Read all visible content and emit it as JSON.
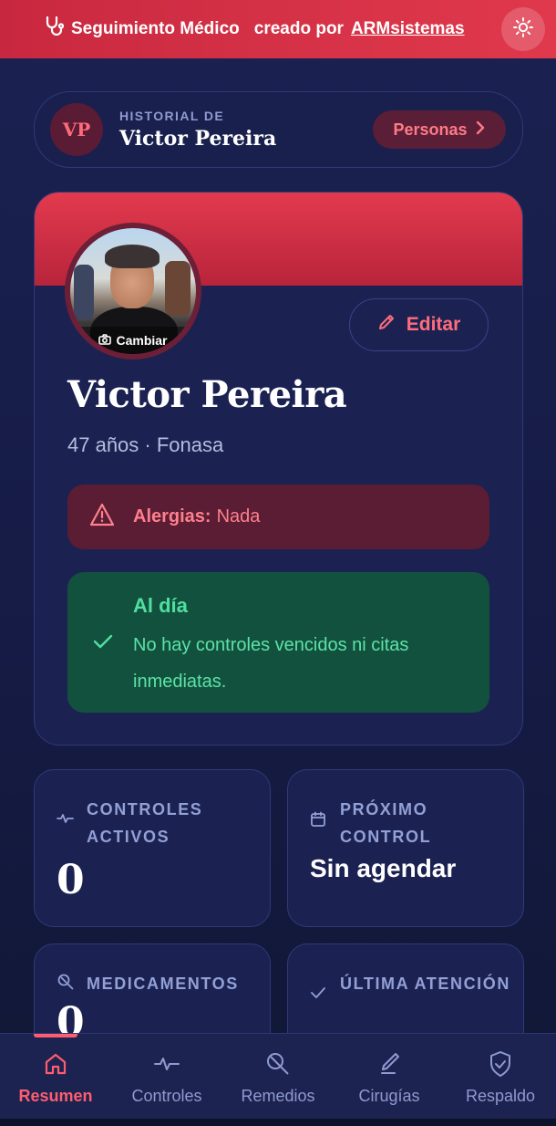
{
  "topbar": {
    "app_name": "Seguimiento Médico",
    "creator_prefix": "creado por",
    "creator_link": "ARMsistemas"
  },
  "header": {
    "initials": "VP",
    "kicker": "HISTORIAL DE",
    "name": "Victor Pereira",
    "personas_label": "Personas"
  },
  "profile": {
    "photo_action": "Cambiar",
    "edit_label": "Editar",
    "name": "Victor Pereira",
    "meta": "47 años · Fonasa",
    "allergy_label": "Alergias:",
    "allergy_value": "Nada",
    "status_title": "Al día",
    "status_text": "No hay controles vencidos ni citas inmediatas."
  },
  "stats": {
    "controles_label": "CONTROLES ACTIVOS",
    "controles_value": "0",
    "proximo_label": "PRÓXIMO CONTROL",
    "proximo_value": "Sin agendar",
    "medicamentos_label": "MEDICAMENTOS",
    "medicamentos_value": "0",
    "ultima_label": "ÚLTIMA ATENCIÓN"
  },
  "nav": {
    "items": [
      {
        "label": "Resumen",
        "icon": "home-icon",
        "active": true
      },
      {
        "label": "Controles",
        "icon": "pulse-icon",
        "active": false
      },
      {
        "label": "Remedios",
        "icon": "pill-icon",
        "active": false
      },
      {
        "label": "Cirugías",
        "icon": "scalpel-icon",
        "active": false
      },
      {
        "label": "Respaldo",
        "icon": "shield-check-icon",
        "active": false
      }
    ]
  },
  "colors": {
    "accent": "#e0384c",
    "background": "#141a40",
    "success": "#4fe0a0",
    "danger": "#ff7f8c"
  }
}
